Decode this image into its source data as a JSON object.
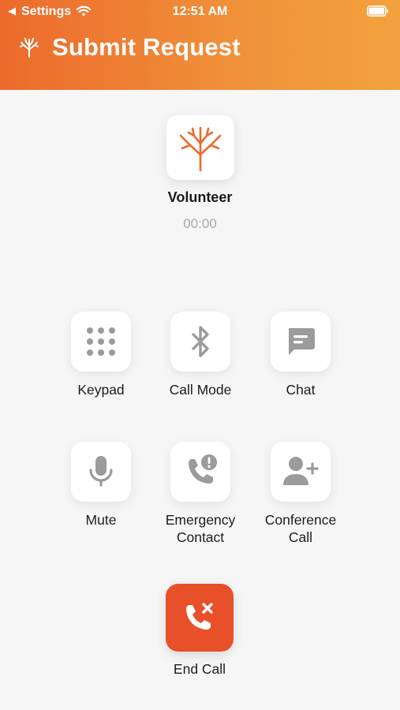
{
  "status_bar": {
    "back_glyph": "◀",
    "back_app": "Settings",
    "time": "12:51 AM",
    "icons": [
      "wifi-icon",
      "battery-icon"
    ]
  },
  "header": {
    "title": "Submit Request",
    "logo_icon": "tree-logo-icon",
    "gradient": [
      "#ec6a2c",
      "#f2a23e"
    ]
  },
  "call": {
    "callee_name": "Volunteer",
    "timer": "00:00",
    "avatar_icon": "tree-logo-icon"
  },
  "controls": [
    {
      "label": "Keypad",
      "icon": "keypad-icon"
    },
    {
      "label": "Call Mode",
      "icon": "bluetooth-icon"
    },
    {
      "label": "Chat",
      "icon": "chat-icon"
    },
    {
      "label": "Mute",
      "icon": "microphone-icon"
    },
    {
      "label_line1": "Emergency",
      "label_line2": "Contact",
      "icon": "phone-alert-icon"
    },
    {
      "label_line1": "Conference",
      "label_line2": "Call",
      "icon": "add-user-icon"
    }
  ],
  "end_call": {
    "label": "End Call",
    "icon": "end-call-icon",
    "color": "#e8502a"
  },
  "colors": {
    "accent": "#ec6a2c",
    "icon_gray": "#9b9b9b",
    "background": "#f6f6f6"
  }
}
